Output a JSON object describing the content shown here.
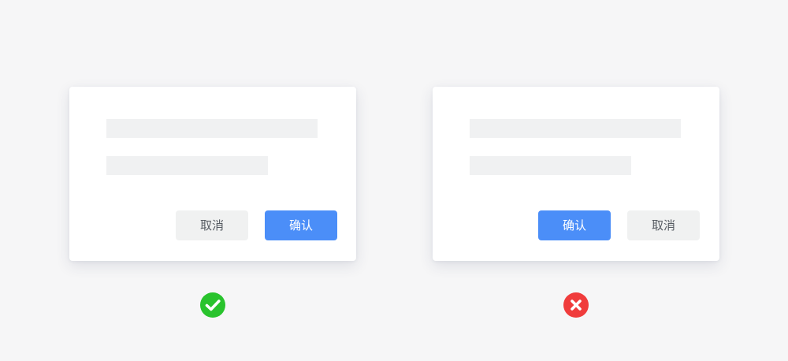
{
  "examples": [
    {
      "buttons": {
        "cancel_label": "取消",
        "confirm_label": "确认"
      },
      "status_icon": "check-circle-icon",
      "status_color": "#29c32d"
    },
    {
      "buttons": {
        "confirm_label": "确认",
        "cancel_label": "取消"
      },
      "status_icon": "x-circle-icon",
      "status_color": "#f03c3c"
    }
  ],
  "colors": {
    "background": "#f6f6f7",
    "dialog": "#ffffff",
    "placeholder": "#f0f1f2",
    "primary_button": "#4b8ef8",
    "secondary_button": "#f0f1f1"
  }
}
